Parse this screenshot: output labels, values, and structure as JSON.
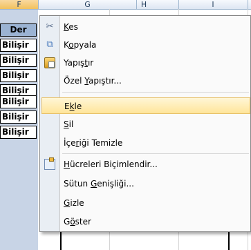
{
  "sheet": {
    "column_headers": [
      "F",
      "G",
      "H",
      "I"
    ],
    "header_cell": "Der",
    "cells": [
      "Bilişir",
      "Bilişir",
      "Bilişir",
      "Bilişir",
      "Bilişir",
      "Bilişir",
      "Bilişir"
    ]
  },
  "menu": {
    "kes": {
      "pre": "",
      "u": "K",
      "post": "es"
    },
    "kopyala": {
      "pre": "K",
      "u": "o",
      "post": "pyala"
    },
    "yapistir": {
      "pre": "Yapış",
      "u": "t",
      "post": "ır"
    },
    "ozel": {
      "pre": "Özel ",
      "u": "Y",
      "post": "apıştır..."
    },
    "ekle": {
      "pre": "E",
      "u": "k",
      "post": "le"
    },
    "sil": {
      "pre": "",
      "u": "S",
      "post": "il"
    },
    "temizle": {
      "pre": "İçe",
      "u": "r",
      "post": "iği Temizle"
    },
    "bicim": {
      "pre": "",
      "u": "H",
      "post": "ücreleri Biçimlendir..."
    },
    "genislik": {
      "pre": "Sütun ",
      "u": "G",
      "post": "enişliği..."
    },
    "gizle": {
      "pre": "",
      "u": "G",
      "post": "izle"
    },
    "goster": {
      "pre": "G",
      "u": "ö",
      "post": "ster"
    }
  },
  "icons": {
    "kes": "scissors-icon",
    "kopyala": "copy-icon",
    "yapistir": "paste-icon",
    "bicim": "format-cells-icon"
  },
  "colors": {
    "highlight": "#ffe59a",
    "icon_column": "#e9eef4",
    "selected_column_header": "#f1c15f"
  }
}
